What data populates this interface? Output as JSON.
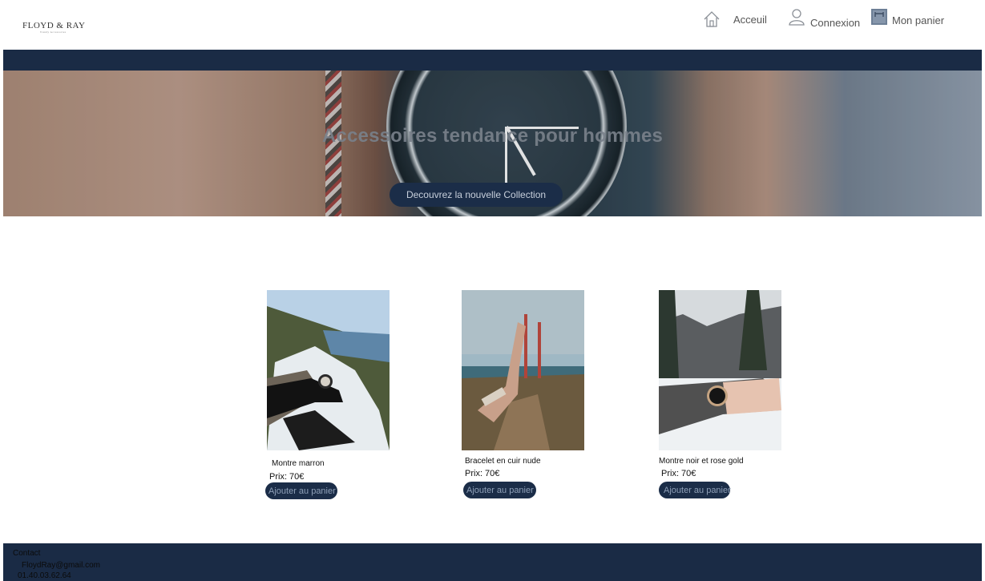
{
  "header": {
    "logo_text": "FLOYD & RAY",
    "logo_tagline": "Trendy Accessories",
    "nav": [
      {
        "label": "Acceuil",
        "icon": "home-icon"
      },
      {
        "label": "Connexion",
        "icon": "user-icon"
      },
      {
        "label": "Mon panier",
        "icon": "cart-icon"
      }
    ]
  },
  "hero": {
    "title": "Accessoires tendance pour hommes",
    "cta_label": "Decouvrez la nouvelle Collection"
  },
  "products": [
    {
      "name": "Montre marron",
      "price": "Prix: 70€",
      "button": "Ajouter au panier"
    },
    {
      "name": "Bracelet en cuir nude",
      "price": "Prix: 70€",
      "button": "Ajouter au panier"
    },
    {
      "name": "Montre noir et  rose gold",
      "price": "Prix: 70€",
      "button": "Ajouter au panier"
    }
  ],
  "footer": {
    "contact_label": "Contact",
    "email": "FloydRay@gmail.com",
    "phone": "01.40.03.62.64"
  },
  "colors": {
    "navy": "#1a2b45",
    "button_bg": "#1b2d48",
    "button_text": "#c7cfdb"
  }
}
